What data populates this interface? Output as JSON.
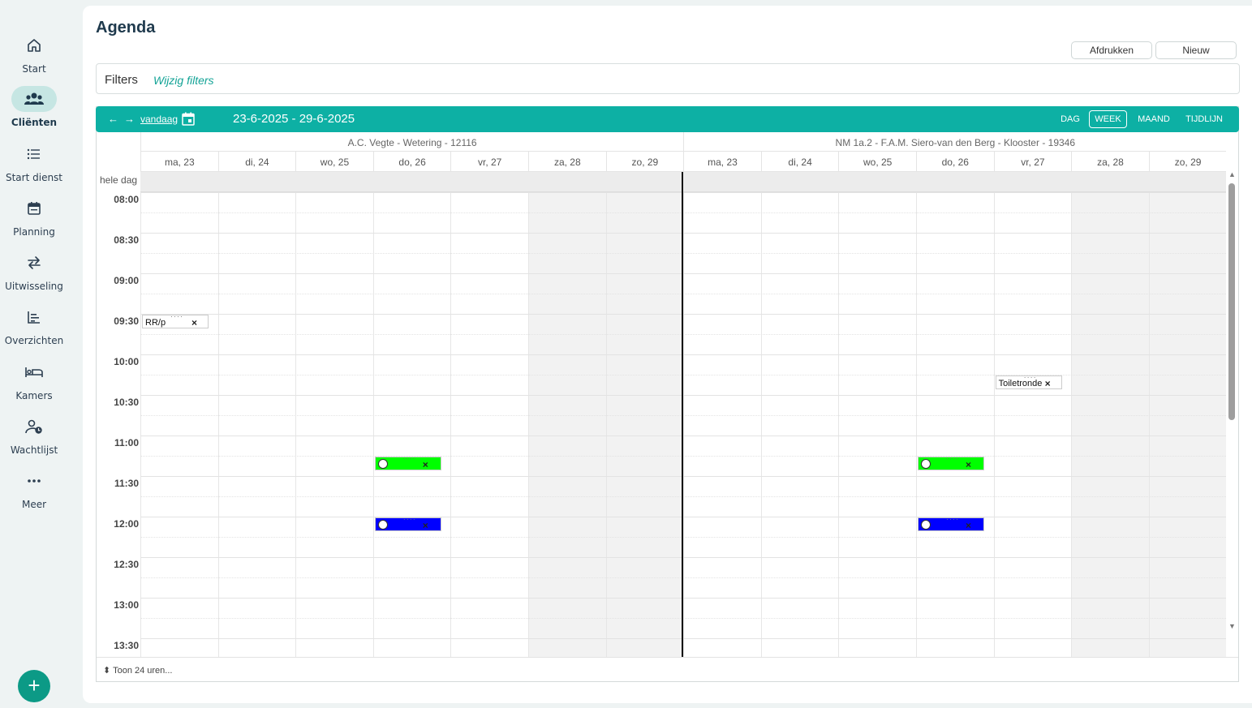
{
  "sidebar": {
    "items": [
      {
        "label": "Start",
        "icon": "home-icon",
        "active": false
      },
      {
        "label": "Cliënten",
        "icon": "users-icon",
        "active": true
      },
      {
        "label": "Start dienst",
        "icon": "list-icon",
        "active": false
      },
      {
        "label": "Planning",
        "icon": "calendar-icon",
        "active": false
      },
      {
        "label": "Uitwisseling",
        "icon": "swap-icon",
        "active": false
      },
      {
        "label": "Overzichten",
        "icon": "chart-icon",
        "active": false
      },
      {
        "label": "Kamers",
        "icon": "bed-icon",
        "active": false
      },
      {
        "label": "Wachtlijst",
        "icon": "user-clock-icon",
        "active": false
      },
      {
        "label": "Meer",
        "icon": "more-icon",
        "active": false
      }
    ],
    "fab_label": "+"
  },
  "page": {
    "title": "Agenda",
    "print_label": "Afdrukken",
    "new_label": "Nieuw"
  },
  "filters": {
    "title": "Filters",
    "link": "Wijzig filters"
  },
  "toolbar": {
    "prev": "←",
    "next": "→",
    "today": "vandaag",
    "range": "23-6-2025 - 29-6-2025",
    "views": [
      "DAG",
      "WEEK",
      "MAAND",
      "TIJDLIJN"
    ],
    "active_view": "WEEK"
  },
  "calendar": {
    "allday_label": "hele dag",
    "resources": [
      {
        "name": "A.C. Vegte - Wetering - 12116"
      },
      {
        "name": "NM 1a.2 - F.A.M. Siero-van den Berg - Klooster - 19346"
      }
    ],
    "days": [
      "ma, 23",
      "di, 24",
      "wo, 25",
      "do, 26",
      "vr, 27",
      "za, 28",
      "zo, 29"
    ],
    "weekend_days": [
      "za, 28",
      "zo, 29"
    ],
    "times": [
      "08:00",
      "08:30",
      "09:00",
      "09:30",
      "10:00",
      "10:30",
      "11:00",
      "11:30",
      "12:00",
      "12:30",
      "13:00",
      "13:30"
    ],
    "events": [
      {
        "resource": 0,
        "day": 0,
        "start": "09:30",
        "text": "RR/p",
        "color": "#ffffff",
        "icon": false
      },
      {
        "resource": 0,
        "day": 3,
        "start": "11:15",
        "text": "",
        "color": "#00ff00",
        "icon": true
      },
      {
        "resource": 0,
        "day": 3,
        "start": "12:00",
        "text": "",
        "color": "#0000ff",
        "icon": true
      },
      {
        "resource": 1,
        "day": 4,
        "start": "10:15",
        "text": "Toiletronde",
        "color": "#ffffff",
        "icon": false
      },
      {
        "resource": 1,
        "day": 3,
        "start": "11:15",
        "text": "",
        "color": "#00ff00",
        "icon": true
      },
      {
        "resource": 1,
        "day": 3,
        "start": "12:00",
        "text": "",
        "color": "#0000ff",
        "icon": true
      }
    ],
    "close_glyph": "×",
    "footer_toggle": "Toon 24 uren..."
  },
  "colors": {
    "accent": "#0db0a4",
    "sidebar_bg": "#eef3f3",
    "active_nav": "#c6e6e3"
  }
}
